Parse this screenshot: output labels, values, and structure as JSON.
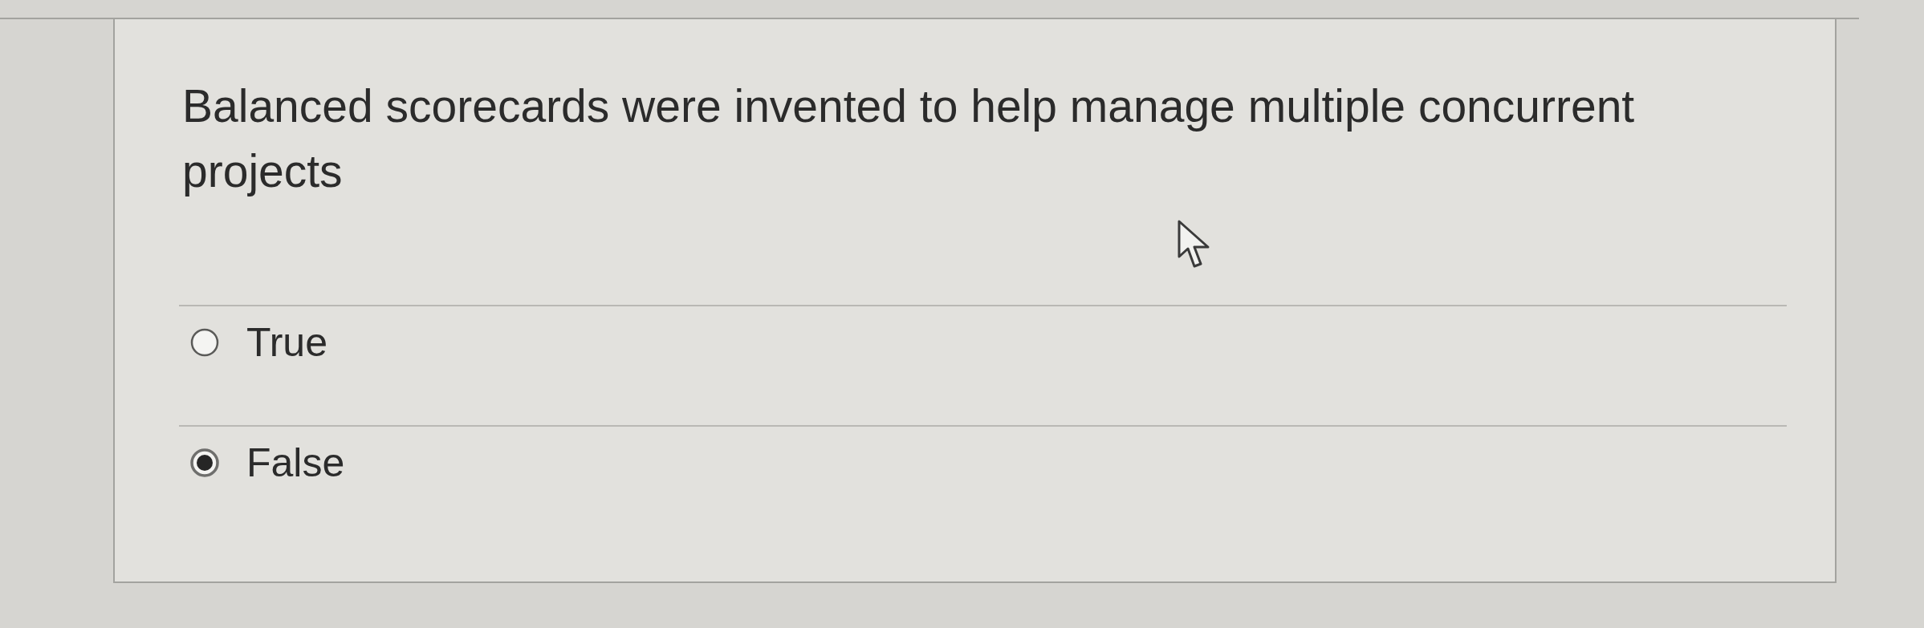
{
  "question": {
    "text": "Balanced scorecards were invented to help manage multiple concurrent projects"
  },
  "options": [
    {
      "label": "True",
      "selected": false
    },
    {
      "label": "False",
      "selected": true
    }
  ]
}
